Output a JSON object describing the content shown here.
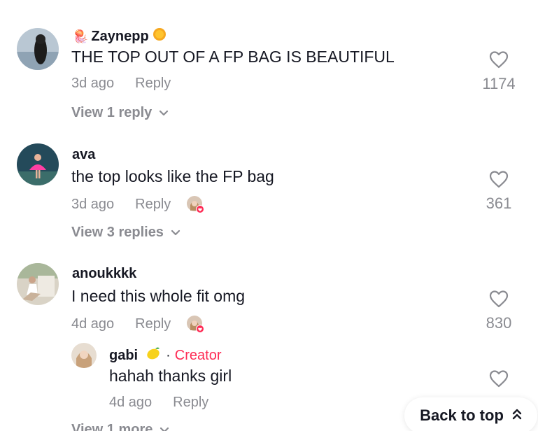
{
  "comments": [
    {
      "username": "Zaynepp",
      "prefix_emoji": "🪼",
      "suffix_emoji": "sun",
      "text": "THE TOP OUT OF A FP BAG IS BEAUTIFUL",
      "time": "3d ago",
      "reply_label": "Reply",
      "likes": "1174",
      "view_replies": "View 1 reply"
    },
    {
      "username": "ava",
      "text": "the top looks like the FP bag",
      "time": "3d ago",
      "reply_label": "Reply",
      "likes": "361",
      "view_replies": "View 3 replies"
    },
    {
      "username": "anoukkkk",
      "text": "I need this whole fit omg",
      "time": "4d ago",
      "reply_label": "Reply",
      "likes": "830"
    }
  ],
  "reply": {
    "username": "gabi",
    "emoji": "🍋",
    "separator": "·",
    "creator_label": "Creator",
    "text": "hahah thanks girl",
    "time": "4d ago",
    "reply_label": "Reply"
  },
  "more_replies": "View 1 more",
  "back_to_top": "Back to top",
  "colors": {
    "text": "#161823",
    "muted": "#8a8b91",
    "creator": "#fe2c55",
    "heart_badge": "#fe2c55"
  },
  "icons": [
    "heart-outline-icon",
    "chevron-down-icon",
    "double-chevron-up-icon",
    "sun-emoji-icon",
    "jellyfish-emoji-icon",
    "lemon-emoji-icon",
    "liked-heart-badge-icon"
  ]
}
